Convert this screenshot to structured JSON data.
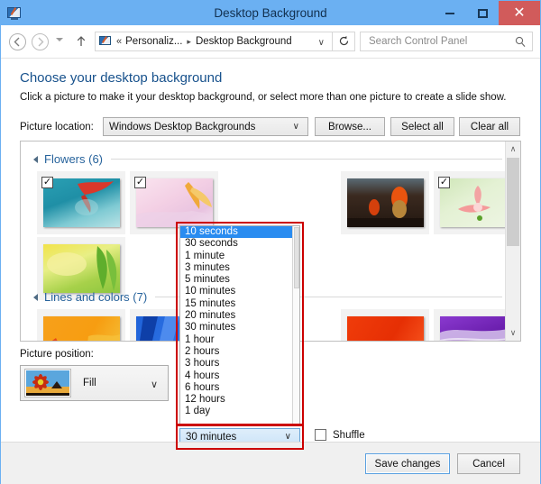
{
  "window": {
    "title": "Desktop Background",
    "icon": "desktop-background-icon",
    "minimize_label": "–",
    "maximize_label": "□",
    "close_label": "✕"
  },
  "navbar": {
    "back_glyph": "←",
    "forward_glyph": "→",
    "up_glyph": "↑",
    "breadcrumb_prefix": "«",
    "breadcrumb": [
      "Personaliz...",
      "Desktop Background"
    ],
    "breadcrumb_sep": "▸",
    "address_chevron": "∨",
    "refresh_glyph": "↻",
    "search_placeholder": "Search Control Panel",
    "search_value": ""
  },
  "main": {
    "heading": "Choose your desktop background",
    "subtext": "Click a picture to make it your desktop background, or select more than one picture to create a slide show.",
    "picture_location": {
      "label": "Picture location:",
      "value": "Windows Desktop Backgrounds",
      "chevron": "∨"
    },
    "buttons": {
      "browse": "Browse...",
      "select_all": "Select all",
      "clear_all": "Clear all"
    },
    "groups": [
      {
        "name": "flowers",
        "label": "Flowers (6)",
        "thumbs": [
          {
            "name": "thumb-flower-teal-red",
            "checked": true,
            "colors": [
              "#1b7f95",
              "#2e9bab",
              "#d93a2b"
            ]
          },
          {
            "name": "thumb-flower-pink",
            "checked": true,
            "colors": [
              "#f6dce9",
              "#efc9df",
              "#f0a93a"
            ]
          },
          {
            "name": "thumb-flower-dark-tulip",
            "checked": false,
            "colors": [
              "#3a2a20",
              "#1d140e",
              "#e8540f"
            ]
          },
          {
            "name": "thumb-flower-green-pink",
            "checked": true,
            "colors": [
              "#cfe6b8",
              "#e9f3d8",
              "#f08e8e"
            ]
          },
          {
            "name": "thumb-flower-lime",
            "checked": false,
            "colors": [
              "#d5e34a",
              "#8cc63f",
              "#f4f0a0"
            ]
          }
        ]
      },
      {
        "name": "lines-and-colors",
        "label": "Lines and colors (7)",
        "thumbs": [
          {
            "name": "thumb-lines-orange",
            "checked": false,
            "colors": [
              "#f5a623",
              "#f79d11",
              "#e8491a"
            ]
          },
          {
            "name": "thumb-lines-blue",
            "checked": false,
            "colors": [
              "#1f62d8",
              "#3b7ae8",
              "#0e3fa8"
            ]
          },
          {
            "name": "thumb-lines-red",
            "checked": false,
            "colors": [
              "#f03c0a",
              "#d72c05",
              "#fa5a22"
            ]
          },
          {
            "name": "thumb-lines-purple",
            "checked": false,
            "colors": [
              "#7a2bbd",
              "#5a1790",
              "#d7c4ec"
            ]
          }
        ]
      }
    ],
    "picture_position": {
      "label": "Picture position:",
      "value": "Fill",
      "chevron": "∨",
      "thumb_name": "thumb-daisy-preview"
    },
    "interval": {
      "value": "30 minutes",
      "chevron": "∨",
      "options": [
        "10 seconds",
        "30 seconds",
        "1 minute",
        "3 minutes",
        "5 minutes",
        "10 minutes",
        "15 minutes",
        "20 minutes",
        "30 minutes",
        "1 hour",
        "2 hours",
        "3 hours",
        "4 hours",
        "6 hours",
        "12 hours",
        "1 day"
      ],
      "highlighted_option": "10 seconds"
    },
    "shuffle": {
      "label": "Shuffle",
      "checked": false
    },
    "scrollbar": {
      "up_glyph": "∧",
      "down_glyph": "∨"
    }
  },
  "footer": {
    "save": "Save changes",
    "cancel": "Cancel"
  },
  "colors": {
    "titlebar": "#6BB0F2",
    "close_button": "#d15b5b",
    "heading": "#17518c",
    "group_label": "#27639c",
    "selection": "#2a8cf0",
    "annotation_red": "#cc0000"
  }
}
